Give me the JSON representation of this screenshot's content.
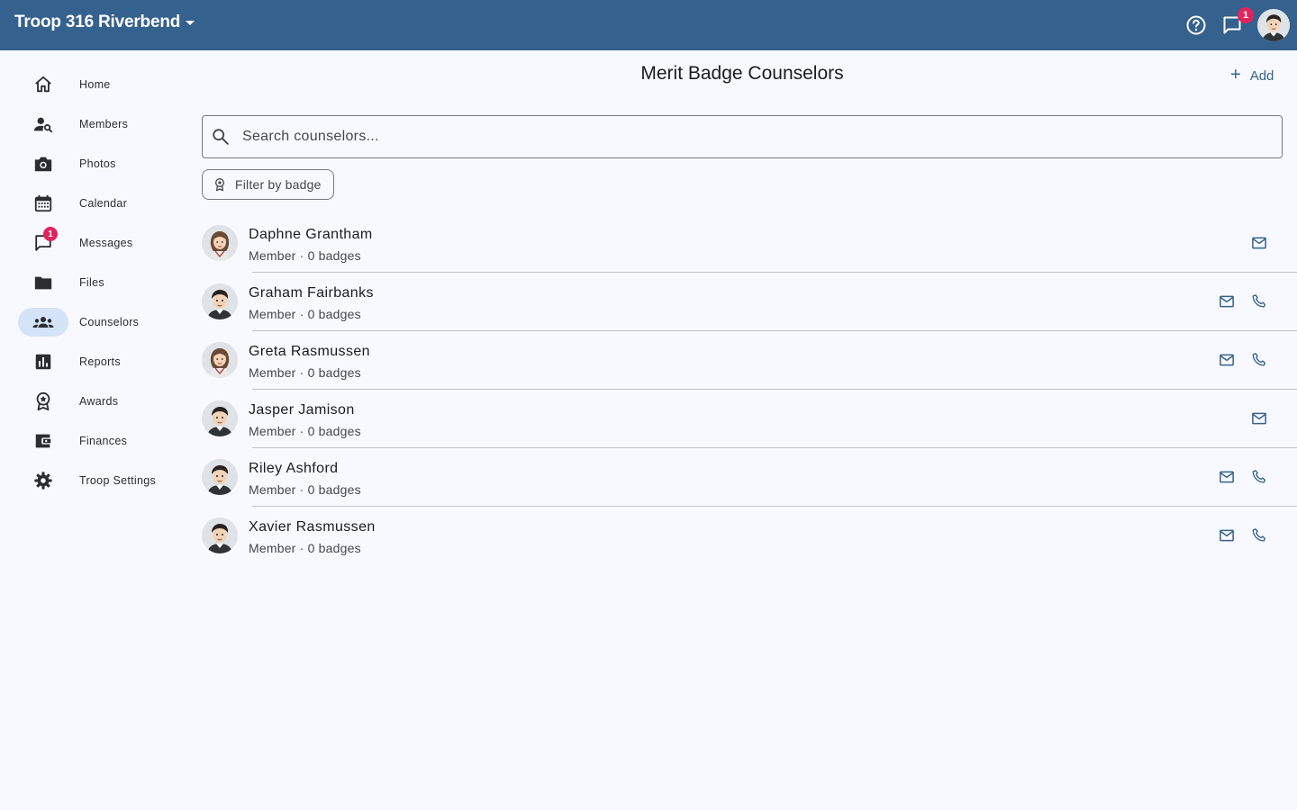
{
  "header": {
    "troop_name": "Troop 316 Riverbend",
    "messages_badge": "1"
  },
  "sidebar": {
    "items": [
      {
        "label": "Home",
        "icon": "home-icon"
      },
      {
        "label": "Members",
        "icon": "person-search-icon"
      },
      {
        "label": "Photos",
        "icon": "camera-icon"
      },
      {
        "label": "Calendar",
        "icon": "calendar-icon"
      },
      {
        "label": "Messages",
        "icon": "chat-icon",
        "badge": "1"
      },
      {
        "label": "Files",
        "icon": "folder-icon"
      },
      {
        "label": "Counselors",
        "icon": "groups-icon",
        "active": true
      },
      {
        "label": "Reports",
        "icon": "bar-chart-icon"
      },
      {
        "label": "Awards",
        "icon": "award-icon"
      },
      {
        "label": "Finances",
        "icon": "wallet-icon"
      },
      {
        "label": "Troop Settings",
        "icon": "gear-icon"
      }
    ]
  },
  "main": {
    "title": "Merit Badge Counselors",
    "add_label": "Add",
    "search_placeholder": "Search counselors...",
    "filter_label": "Filter by badge"
  },
  "counselors": [
    {
      "name": "Daphne Grantham",
      "subtitle": "Member · 0 badges",
      "avatar": "female",
      "email": true,
      "phone": false
    },
    {
      "name": "Graham Fairbanks",
      "subtitle": "Member · 0 badges",
      "avatar": "male",
      "email": true,
      "phone": true
    },
    {
      "name": "Greta Rasmussen",
      "subtitle": "Member · 0 badges",
      "avatar": "female",
      "email": true,
      "phone": true
    },
    {
      "name": "Jasper Jamison",
      "subtitle": "Member · 0 badges",
      "avatar": "male",
      "email": true,
      "phone": false
    },
    {
      "name": "Riley Ashford",
      "subtitle": "Member · 0 badges",
      "avatar": "male",
      "email": true,
      "phone": true
    },
    {
      "name": "Xavier Rasmussen",
      "subtitle": "Member · 0 badges",
      "avatar": "male",
      "email": true,
      "phone": true
    }
  ],
  "colors": {
    "primary": "#35618e",
    "background": "#f8f9fe",
    "badge": "#e0245e",
    "active_nav": "#d4e3f7"
  }
}
